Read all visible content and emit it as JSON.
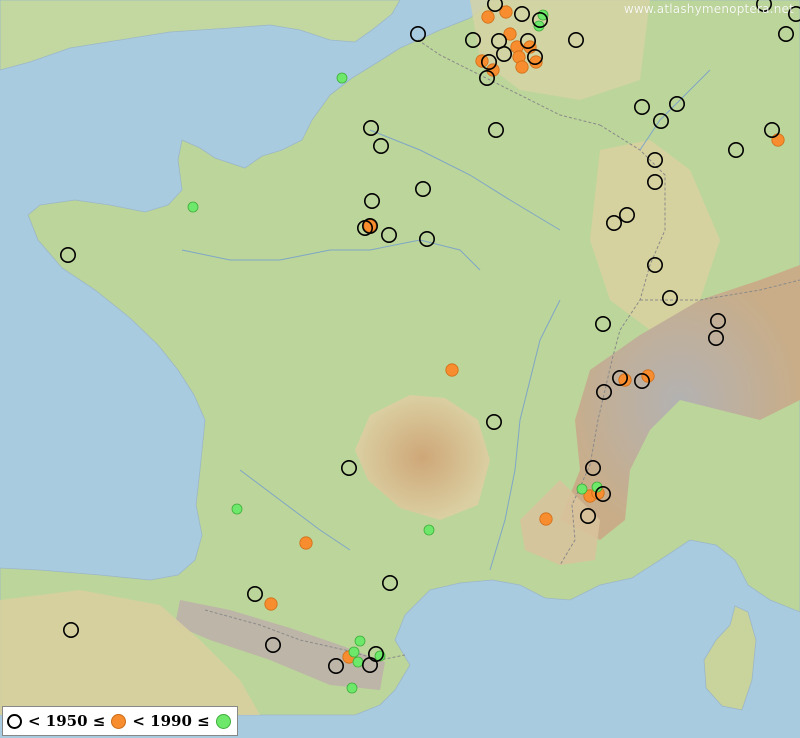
{
  "watermark": "www.atlashymenoptera.net",
  "legend": {
    "label_1": "< 1950 ≤",
    "label_2": "< 1990 ≤"
  },
  "colors": {
    "sea": "#a9cbe0",
    "lowland": "#bcd59a",
    "upland": "#ddd2a4",
    "mountain": "#c4a884",
    "high_mountain": "#b9b6b4",
    "border": "#8a8a8a",
    "river": "#7fa6c6",
    "old_marker": "#000000",
    "mid_marker": "#f78d2e",
    "new_marker": "#6ee86a"
  },
  "records": {
    "before_1950": [
      [
        495,
        4
      ],
      [
        522,
        14
      ],
      [
        540,
        20
      ],
      [
        418,
        34
      ],
      [
        473,
        40
      ],
      [
        499,
        41
      ],
      [
        528,
        41
      ],
      [
        576,
        40
      ],
      [
        489,
        62
      ],
      [
        487,
        78
      ],
      [
        504,
        54
      ],
      [
        535,
        57
      ],
      [
        764,
        4
      ],
      [
        786,
        34
      ],
      [
        796,
        14
      ],
      [
        371,
        128
      ],
      [
        381,
        146
      ],
      [
        496,
        130
      ],
      [
        642,
        107
      ],
      [
        661,
        121
      ],
      [
        677,
        104
      ],
      [
        772,
        130
      ],
      [
        736,
        150
      ],
      [
        655,
        160
      ],
      [
        655,
        182
      ],
      [
        423,
        189
      ],
      [
        372,
        201
      ],
      [
        365,
        228
      ],
      [
        370,
        226
      ],
      [
        389,
        235
      ],
      [
        427,
        239
      ],
      [
        614,
        223
      ],
      [
        627,
        215
      ],
      [
        68,
        255
      ],
      [
        655,
        265
      ],
      [
        670,
        298
      ],
      [
        603,
        324
      ],
      [
        718,
        321
      ],
      [
        716,
        338
      ],
      [
        604,
        392
      ],
      [
        642,
        381
      ],
      [
        620,
        378
      ],
      [
        494,
        422
      ],
      [
        349,
        468
      ],
      [
        593,
        468
      ],
      [
        603,
        494
      ],
      [
        588,
        516
      ],
      [
        390,
        583
      ],
      [
        255,
        594
      ],
      [
        71,
        630
      ],
      [
        273,
        645
      ],
      [
        336,
        666
      ],
      [
        370,
        665
      ],
      [
        376,
        654
      ]
    ],
    "between_1950_1990": [
      [
        488,
        17
      ],
      [
        506,
        12
      ],
      [
        510,
        34
      ],
      [
        482,
        61
      ],
      [
        493,
        70
      ],
      [
        517,
        47
      ],
      [
        530,
        47
      ],
      [
        519,
        57
      ],
      [
        536,
        62
      ],
      [
        522,
        67
      ],
      [
        778,
        140
      ],
      [
        370,
        226
      ],
      [
        452,
        370
      ],
      [
        625,
        380
      ],
      [
        648,
        376
      ],
      [
        590,
        496
      ],
      [
        598,
        493
      ],
      [
        546,
        519
      ],
      [
        306,
        543
      ],
      [
        271,
        604
      ],
      [
        349,
        657
      ]
    ],
    "after_1990": [
      [
        543,
        15
      ],
      [
        539,
        26
      ],
      [
        342,
        78
      ],
      [
        193,
        207
      ],
      [
        582,
        489
      ],
      [
        597,
        487
      ],
      [
        237,
        509
      ],
      [
        429,
        530
      ],
      [
        360,
        641
      ],
      [
        354,
        652
      ],
      [
        358,
        662
      ],
      [
        380,
        656
      ],
      [
        352,
        688
      ]
    ]
  }
}
